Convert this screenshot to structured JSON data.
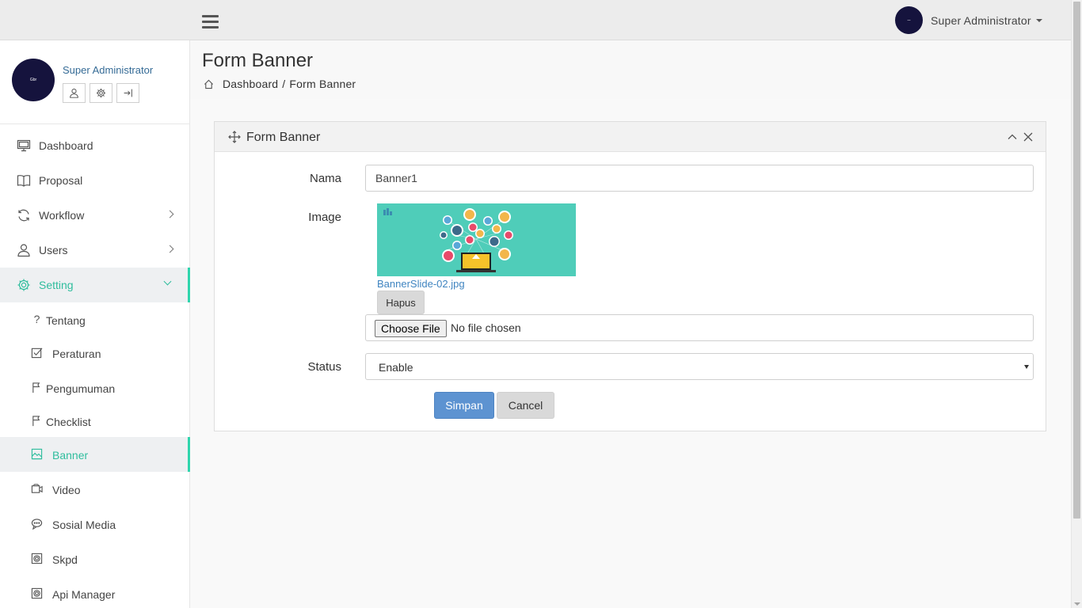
{
  "header": {
    "user_name": "Super Administrator",
    "avatar_text": "--"
  },
  "sidebar": {
    "profile": {
      "name": "Super Administrator",
      "avatar_text": "Gbr"
    },
    "menu": [
      {
        "label": "Dashboard",
        "icon": "monitor-icon"
      },
      {
        "label": "Proposal",
        "icon": "book-icon"
      },
      {
        "label": "Workflow",
        "icon": "refresh-icon",
        "has_children": true
      },
      {
        "label": "Users",
        "icon": "user-icon",
        "has_children": true
      },
      {
        "label": "Setting",
        "icon": "gear-icon",
        "has_children": true,
        "open": true
      }
    ],
    "submenu": [
      {
        "label": "Tentang",
        "icon": "question-icon"
      },
      {
        "label": "Peraturan",
        "icon": "checkbox-icon"
      },
      {
        "label": "Pengumuman",
        "icon": "flag-icon"
      },
      {
        "label": "Checklist",
        "icon": "flag-icon"
      },
      {
        "label": "Banner",
        "icon": "image-icon",
        "active": true
      },
      {
        "label": "Video",
        "icon": "video-icon"
      },
      {
        "label": "Sosial Media",
        "icon": "chat-icon"
      },
      {
        "label": "Skpd",
        "icon": "settings-square-icon"
      },
      {
        "label": "Api Manager",
        "icon": "settings-square-icon"
      }
    ]
  },
  "page": {
    "title": "Form Banner",
    "breadcrumb": [
      "Dashboard",
      "/",
      "Form Banner"
    ]
  },
  "panel": {
    "title": "Form Banner",
    "fields": {
      "nama_label": "Nama",
      "nama_value": "Banner1",
      "image_label": "Image",
      "image_filename": "BannerSlide-02.jpg",
      "hapus_label": "Hapus",
      "choose_file_label": "Choose File",
      "no_file_text": "No file chosen",
      "status_label": "Status",
      "status_value": "Enable"
    },
    "buttons": {
      "simpan": "Simpan",
      "cancel": "Cancel"
    }
  },
  "colors": {
    "accent": "#2fbd9d",
    "primary_button": "#5d93d1",
    "avatar_bg": "#15133d",
    "banner_bg": "#4fcdb9"
  }
}
